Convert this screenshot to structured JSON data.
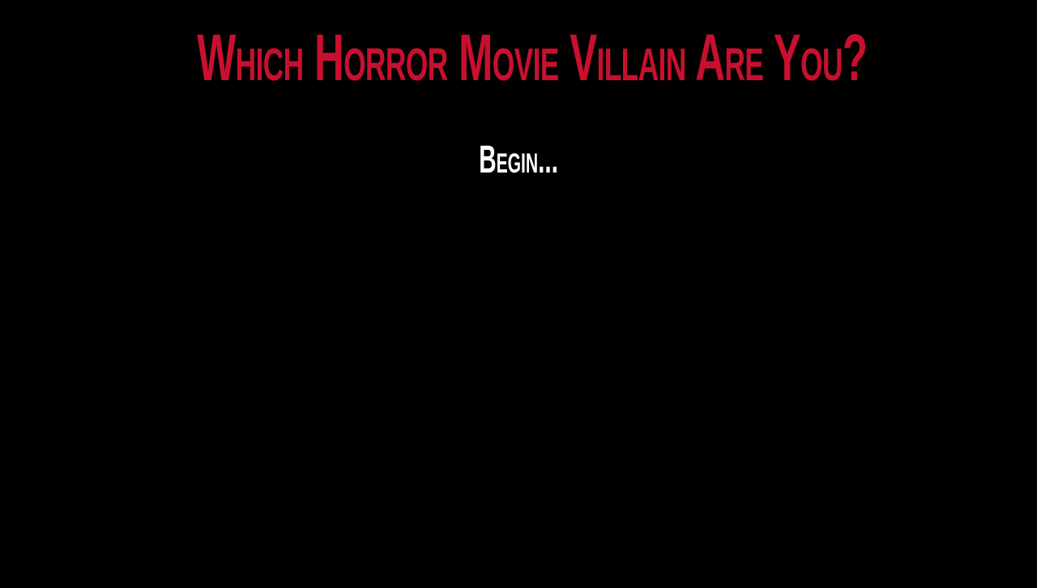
{
  "page": {
    "title": "Which Horror Movie Villain Are You?",
    "begin_label": "Begin..."
  },
  "colors": {
    "background": "#000000",
    "title": "#c8102e",
    "begin": "#ffffff"
  }
}
